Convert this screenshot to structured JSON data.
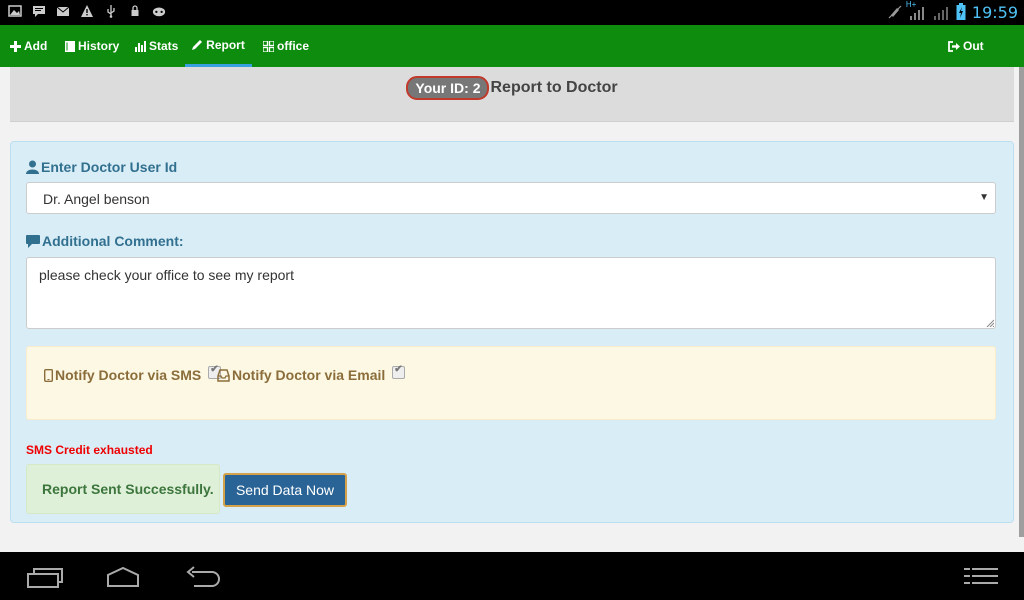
{
  "status_bar": {
    "left_icons": [
      "image-icon",
      "message-icon",
      "mail-icon",
      "warning-icon",
      "usb-icon",
      "lock-icon",
      "android-icon"
    ],
    "right_icons": [
      "mute-icon",
      "signal-hplus-icon",
      "signal-icon",
      "battery-icon"
    ],
    "network_label": "H+",
    "time": "19:59"
  },
  "nav": {
    "items": [
      {
        "label": "Add",
        "icon": "plus-icon"
      },
      {
        "label": "History",
        "icon": "book-icon"
      },
      {
        "label": "Stats",
        "icon": "bar-chart-icon"
      },
      {
        "label": "Report",
        "icon": "pencil-icon",
        "active": true
      },
      {
        "label": "office",
        "icon": "grid-icon"
      }
    ],
    "logout": {
      "label": "Out",
      "icon": "logout-icon"
    },
    "active_color": "#3aa0e0",
    "bg_color": "#0d8c0d"
  },
  "header": {
    "id_badge": "Your ID: 2",
    "title": "Report to Doctor"
  },
  "form": {
    "doctor_label": "Enter Doctor User Id",
    "doctor_value": "Dr. Angel benson",
    "comment_label": "Additional Comment:",
    "comment_value": "please check your office to see my report",
    "notify_sms_label": "Notify Doctor via SMS",
    "notify_sms_checked": true,
    "notify_email_label": "Notify Doctor via Email",
    "notify_email_checked": true,
    "sms_error": "SMS Credit exhausted",
    "success_message": "Report Sent Successfully.",
    "send_button": "Send Data Now"
  },
  "bottom_nav": {
    "buttons": [
      "recent-apps-icon",
      "home-icon",
      "back-icon",
      "menu-icon"
    ]
  }
}
